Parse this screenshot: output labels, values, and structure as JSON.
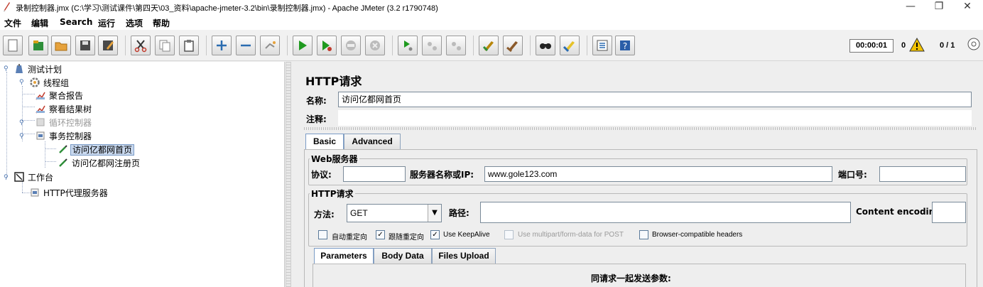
{
  "window": {
    "title": "录制控制器.jmx (C:\\学习\\测试课件\\第四天\\03_资料\\apache-jmeter-3.2\\bin\\录制控制器.jmx) - Apache JMeter (3.2 r1790748)",
    "minimize": "—",
    "maximize": "❐",
    "close": "✕"
  },
  "menu": [
    "文件",
    "编辑",
    "Search",
    "运行",
    "选项",
    "帮助"
  ],
  "toolbar": {
    "timer": "00:00:01",
    "warning_count": "0",
    "threads": "0 / 1",
    "icons": [
      "new-icon",
      "templates-icon",
      "open-icon",
      "save-icon",
      "save-as-icon",
      "cut-icon",
      "copy-icon",
      "paste-icon",
      "expand-icon",
      "collapse-icon",
      "toggle-icon",
      "start-icon",
      "start-no-pause-icon",
      "stop-icon",
      "shutdown-icon",
      "remote-start-icon",
      "remote-stop-icon",
      "remote-shutdown-icon",
      "clear-icon",
      "clear-all-icon",
      "search-icon",
      "reset-search-icon",
      "function-helper-icon",
      "help-icon",
      "warning-icon",
      "threads-icon"
    ]
  },
  "tree": {
    "items": [
      {
        "label": "测试计划"
      },
      {
        "label": "线程组"
      },
      {
        "label": "聚合报告"
      },
      {
        "label": "察看结果树"
      },
      {
        "label": "循环控制器"
      },
      {
        "label": "事务控制器"
      },
      {
        "label": "访问亿都网首页"
      },
      {
        "label": "访问亿都网注册页"
      },
      {
        "label": "工作台"
      },
      {
        "label": "HTTP代理服务器"
      }
    ]
  },
  "http": {
    "heading": "HTTP请求",
    "name_label": "名称:",
    "name_value": "访问亿都网首页",
    "comment_label": "注释:",
    "tabs": [
      "Basic",
      "Advanced"
    ],
    "web_server_group": "Web服务器",
    "protocol_label": "协议:",
    "protocol_value": "",
    "server_label": "服务器名称或IP:",
    "server_value": "www.gole123.com",
    "port_label": "端口号:",
    "port_value": "",
    "request_group": "HTTP请求",
    "method_label": "方法:",
    "method_value": "GET",
    "path_label": "路径:",
    "path_value": "",
    "encoding_label": "Content encoding:",
    "encoding_value": "",
    "checkboxes": [
      {
        "label": "自动重定向",
        "checked": false,
        "enabled": true
      },
      {
        "label": "跟随重定向",
        "checked": true,
        "enabled": true
      },
      {
        "label": "Use KeepAlive",
        "checked": true,
        "enabled": true
      },
      {
        "label": "Use multipart/form-data for POST",
        "checked": false,
        "enabled": false
      },
      {
        "label": "Browser-compatible headers",
        "checked": false,
        "enabled": true
      }
    ],
    "subtabs": [
      "Parameters",
      "Body Data",
      "Files Upload"
    ],
    "params_title": "同请求一起发送参数:"
  },
  "colors": {
    "selection": "#c8d8ee",
    "accent": "#7a9bc6",
    "start_green": "#1f9a1f"
  }
}
